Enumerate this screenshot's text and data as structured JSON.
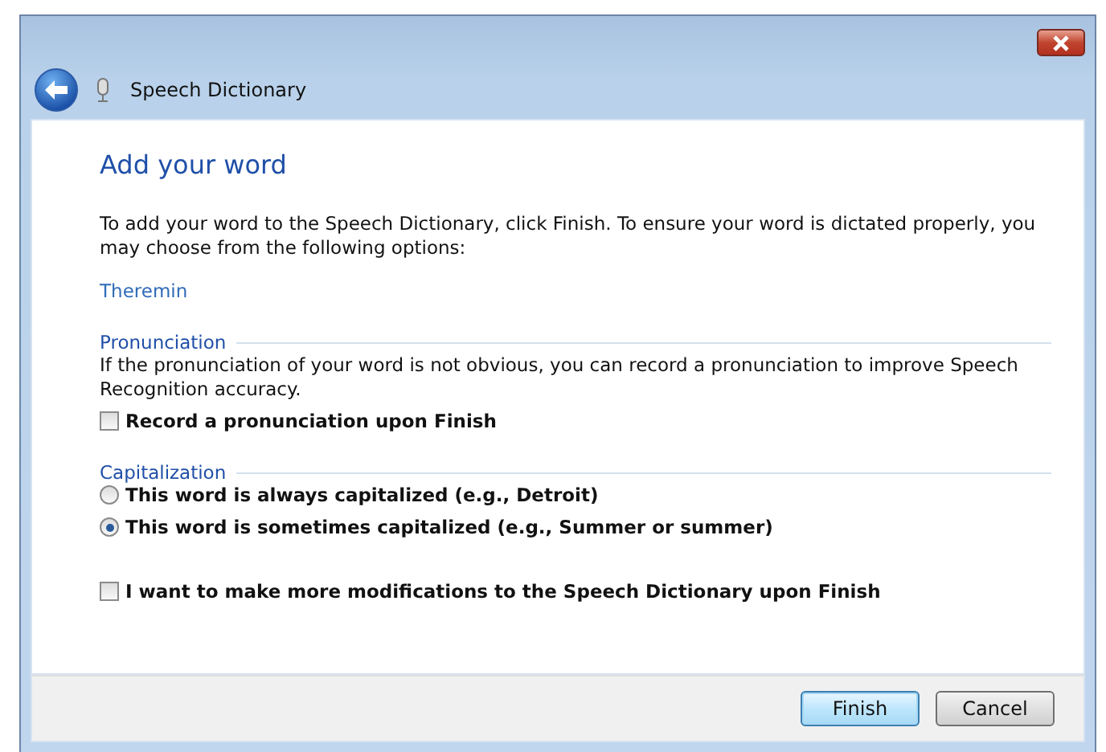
{
  "window": {
    "title": "Speech Dictionary"
  },
  "heading": "Add your word",
  "intro": "To add your word to the Speech Dictionary, click Finish.  To ensure your word is dictated properly, you may choose from the following options:",
  "word": "Theremin",
  "sections": [
    {
      "title": "Pronunciation",
      "text": "If the pronunciation of your word is not obvious, you can record a pronunciation to improve Speech Recognition accuracy.",
      "options": [
        {
          "kind": "checkbox",
          "label": "Record a pronunciation upon Finish",
          "checked": false
        }
      ]
    },
    {
      "title": "Capitalization",
      "options": [
        {
          "kind": "radio",
          "label": "This word is always capitalized (e.g., Detroit)",
          "selected": false
        },
        {
          "kind": "radio",
          "label": "This word is sometimes capitalized (e.g., Summer or summer)",
          "selected": true
        }
      ]
    }
  ],
  "extra_option": {
    "kind": "checkbox",
    "label": "I want to make more modifications to the Speech Dictionary upon Finish",
    "checked": false
  },
  "buttons": [
    {
      "label": "Finish",
      "default": true
    },
    {
      "label": "Cancel",
      "default": false
    }
  ]
}
